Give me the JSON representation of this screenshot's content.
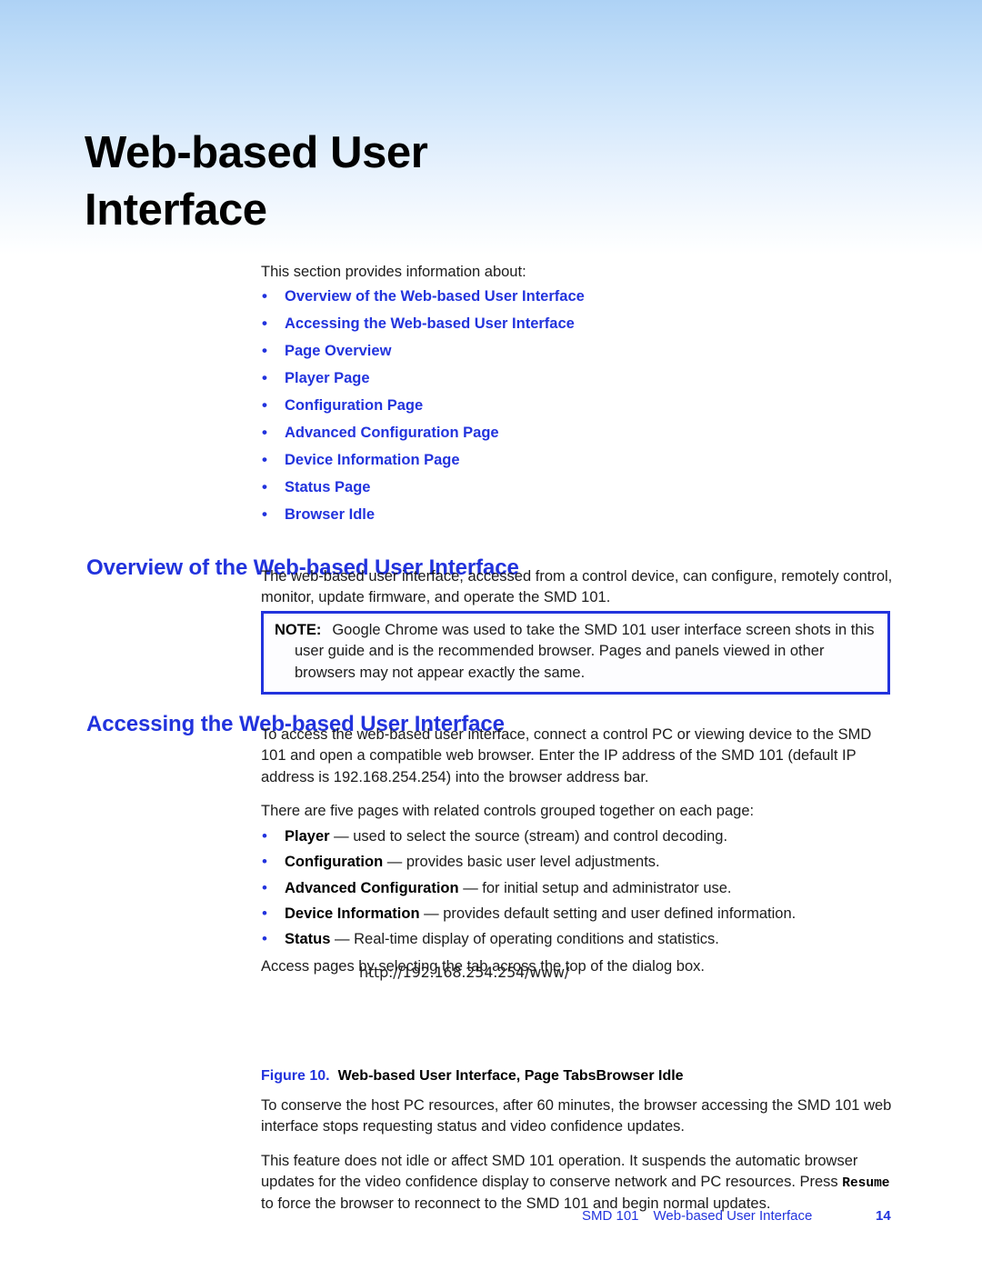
{
  "chapter": {
    "title": "Web-based User Interface"
  },
  "intro": {
    "lead": "This section provides information about:",
    "toc_items": [
      "Overview of the Web-based User Interface",
      "Accessing the Web-based User Interface",
      "Page Overview",
      "Player Page",
      "Configuration Page",
      "Advanced Configuration Page",
      "Device Information Page",
      "Status Page",
      "Browser Idle"
    ]
  },
  "overview": {
    "heading": "Overview of the Web-based User Interface",
    "body": "The web-based user interface, accessed from a control device, can configure, remotely control, monitor, update firmware, and operate the SMD 101."
  },
  "note": {
    "label": "NOTE:",
    "text": "Google Chrome was used to take the SMD 101 user interface screen shots in this user guide and is the recommended browser. Pages and panels viewed in other browsers may not appear exactly the same."
  },
  "accessing": {
    "heading": "Accessing the Web-based User Interface",
    "body": "To access the web-based user interface, connect a control PC or viewing device to the SMD 101 and open a compatible web browser. Enter the IP address of the SMD 101 (default IP address is 192.168.254.254) into the browser address bar.",
    "pages_lead": "There are five pages with related controls grouped together on each page:",
    "page_items": [
      {
        "term": "Player",
        "dash": "—",
        "desc": "used to select the source (stream) and control decoding."
      },
      {
        "term": "Configuration",
        "dash": "—",
        "desc": "provides basic user level adjustments."
      },
      {
        "term": "Advanced Configuration",
        "dash": "—",
        "desc": "for initial setup and administrator use."
      },
      {
        "term": "Device Information",
        "dash": "—",
        "desc": "provides default setting and user defined information."
      },
      {
        "term": "Status",
        "dash": "—",
        "desc": "Real-time display of operating conditions and statistics."
      }
    ],
    "tab_hint": "Access pages by selecting the tab across the top of the dialog box."
  },
  "figure": {
    "url": "http://192.168.254.254/www/",
    "number": "Figure 10.",
    "caption": "Web-based User Interface, Page TabsBrowser Idle"
  },
  "browser_idle": {
    "para1": "To conserve the host PC resources, after 60 minutes, the browser accessing the SMD 101 web interface stops requesting status and video confidence updates.",
    "para2_before": "This feature does not idle or affect SMD 101 operation. It suspends the automatic browser updates for the video confidence display to conserve network and PC resources. Press ",
    "para2_button": "Resume",
    "para2_after": " to force the browser to reconnect to the SMD 101 and begin normal updates."
  },
  "footer": {
    "product": "SMD 101",
    "doc_name": "Web-based User Interface",
    "page_number": "14"
  },
  "colors": {
    "link_blue": "#2233dd",
    "header_gradient_top": "#aed2f5",
    "note_border": "#2233dd",
    "body_text": "#1c1c1c"
  }
}
